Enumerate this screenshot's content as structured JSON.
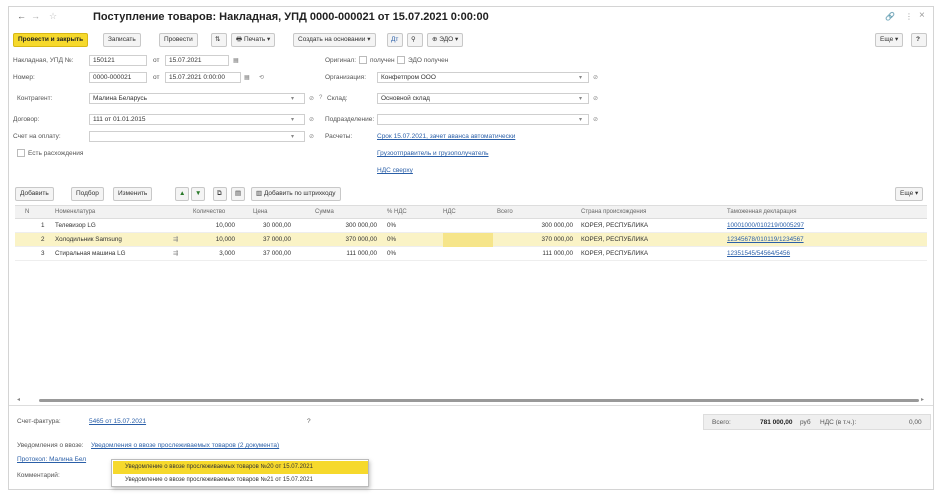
{
  "titlebar": {
    "back": "←",
    "forward": "→",
    "title": "Поступление товаров: Накладная, УПД 0000-000021 от 15.07.2021 0:00:00",
    "link_icon": "🔗",
    "more": "⋮",
    "close": "×"
  },
  "toolbar": {
    "post_close": "Провести и закрыть",
    "save": "Записать",
    "post": "Провести",
    "print": "Печать",
    "create_based": "Создать на основании",
    "edo": "ЭДО",
    "more": "Еще",
    "help": "?"
  },
  "form": {
    "invoice_label": "Накладная, УПД №:",
    "invoice_value": "150121",
    "invoice_from": "от",
    "invoice_date": "15.07.2021",
    "original_label": "Оригинал:",
    "original_received": "получен",
    "original_edo": "ЭДО получен",
    "number_label": "Номер:",
    "number_value": "0000-000021",
    "number_from": "от",
    "number_date": "15.07.2021 0:00:00",
    "org_label": "Организация:",
    "org_value": "Конфетпром ООО",
    "contractor_label": "Контрагент:",
    "contractor_value": "Малина Беларусь",
    "warehouse_label": "Склад:",
    "warehouse_value": "Основной склад",
    "contract_label": "Договор:",
    "contract_value": "111 от 01.01.2015",
    "department_label": "Подразделение:",
    "department_value": "",
    "payment_label": "Счет на оплату:",
    "payment_value": "",
    "settlements_label": "Расчеты:",
    "settlements_link1": "Срок 15.07.2021, зачет аванса автоматически",
    "settlements_link2": "Грузоотправитель и грузополучатель",
    "settlements_link3": "НДС сверху",
    "discrepancy_label": "Есть расхождения"
  },
  "table_toolbar": {
    "add": "Добавить",
    "pick": "Подбор",
    "change": "Изменить",
    "barcode": "Добавить по штрихкоду",
    "more": "Еще"
  },
  "table": {
    "headers": {
      "n": "N",
      "item": "Номенклатура",
      "qty": "Количество",
      "price": "Цена",
      "sum": "Сумма",
      "vat_rate": "% НДС",
      "vat": "НДС",
      "total": "Всего",
      "country": "Страна происхождения",
      "customs": "Таможенная декларация"
    },
    "rows": [
      {
        "n": "1",
        "item": "Телевизор LG",
        "qty": "10,000",
        "price": "30 000,00",
        "sum": "300 000,00",
        "vat_rate": "0%",
        "vat": "",
        "total": "300 000,00",
        "country": "КОРЕЯ, РЕСПУБЛИКА",
        "customs": "10001000/010219/0005297"
      },
      {
        "n": "2",
        "item": "Холодильник Samsung",
        "qty": "10,000",
        "price": "37 000,00",
        "sum": "370 000,00",
        "vat_rate": "0%",
        "vat": "",
        "total": "370 000,00",
        "country": "КОРЕЯ, РЕСПУБЛИКА",
        "customs": "12345678/010119/1234567"
      },
      {
        "n": "3",
        "item": "Стиральная машина LG",
        "qty": "3,000",
        "price": "37 000,00",
        "sum": "111 000,00",
        "vat_rate": "0%",
        "vat": "",
        "total": "111 000,00",
        "country": "КОРЕЯ, РЕСПУБЛИКА",
        "customs": "12351545/54564/5456"
      }
    ]
  },
  "footer": {
    "invoice_label": "Счет-фактура:",
    "invoice_link": "5465 от 15.07.2021",
    "question": "?",
    "total_label": "Всего:",
    "total_value": "781 000,00",
    "currency": "руб",
    "vat_label": "НДС (в т.ч.):",
    "vat_value": "0,00",
    "notice_label": "Уведомления о ввозе:",
    "notice_link": "Уведомления о ввозе прослеживаемых товаров (2 документа)",
    "print_link": "Протокол: Малина Бел",
    "comment_label": "Комментарий:"
  },
  "popup": {
    "item1": "Уведомление о ввозе прослеживаемых товаров №20 от 15.07.2021",
    "item2": "Уведомление о ввозе прослеживаемых товаров №21 от 15.07.2021"
  },
  "colors": {
    "accent": "#f6d92c",
    "selected_row": "#faf3c6",
    "link": "#2a5fa8"
  }
}
